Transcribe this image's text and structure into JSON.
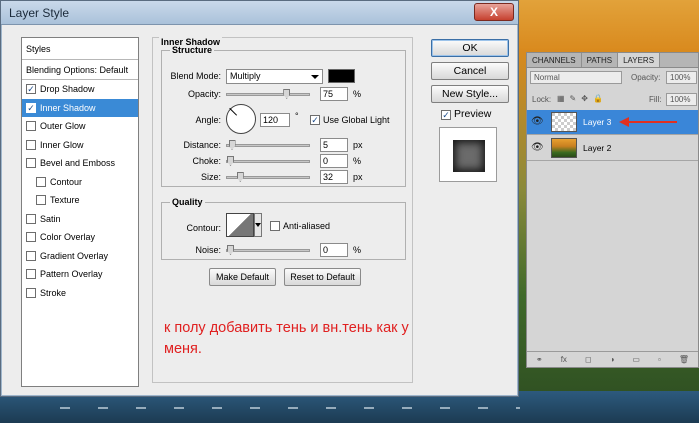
{
  "window": {
    "title": "Layer Style",
    "close": "X"
  },
  "styles": {
    "header": "Styles",
    "blending": "Blending Options: Default",
    "items": [
      {
        "label": "Drop Shadow",
        "checked": true
      },
      {
        "label": "Inner Shadow",
        "checked": true,
        "selected": true
      },
      {
        "label": "Outer Glow",
        "checked": false
      },
      {
        "label": "Inner Glow",
        "checked": false
      },
      {
        "label": "Bevel and Emboss",
        "checked": false
      },
      {
        "label": "Contour",
        "checked": false,
        "indent": true
      },
      {
        "label": "Texture",
        "checked": false,
        "indent": true
      },
      {
        "label": "Satin",
        "checked": false
      },
      {
        "label": "Color Overlay",
        "checked": false
      },
      {
        "label": "Gradient Overlay",
        "checked": false
      },
      {
        "label": "Pattern Overlay",
        "checked": false
      },
      {
        "label": "Stroke",
        "checked": false
      }
    ]
  },
  "inner_shadow": {
    "title": "Inner Shadow",
    "structure": "Structure",
    "blend_mode_label": "Blend Mode:",
    "blend_mode": "Multiply",
    "opacity_label": "Opacity:",
    "opacity": "75",
    "angle_label": "Angle:",
    "angle": "120",
    "degree": "°",
    "use_global_light": "Use Global Light",
    "distance_label": "Distance:",
    "distance": "5",
    "choke_label": "Choke:",
    "choke": "0",
    "size_label": "Size:",
    "size": "32",
    "percent": "%",
    "px": "px",
    "quality": "Quality",
    "contour_label": "Contour:",
    "anti_aliased": "Anti-aliased",
    "noise_label": "Noise:",
    "noise": "0",
    "make_default": "Make Default",
    "reset_default": "Reset to Default",
    "slider_levels": {
      "opacity": 0.75,
      "distance": 0.02,
      "choke": 0.0,
      "size": 0.13,
      "noise": 0.0
    }
  },
  "note": "к полу добавить тень и вн.тень как у меня.",
  "buttons": {
    "ok": "OK",
    "cancel": "Cancel",
    "new_style": "New Style...",
    "preview": "Preview"
  },
  "layers_panel": {
    "tabs": [
      "CHANNELS",
      "PATHS",
      "LAYERS"
    ],
    "blend": "Normal",
    "opacity_label": "Opacity:",
    "opacity": "100%",
    "lock_label": "Lock:",
    "fill_label": "Fill:",
    "fill": "100%",
    "layers": [
      {
        "name": "Layer 3",
        "selected": true
      },
      {
        "name": "Layer 2",
        "selected": false
      }
    ],
    "footer_icons": [
      "link-icon",
      "fx-icon",
      "mask-icon",
      "adjustment-icon",
      "folder-icon",
      "new-layer-icon",
      "trash-icon"
    ],
    "footer_glyphs": [
      "⚭",
      "fx",
      "◻",
      "◑",
      "▭",
      "▫",
      "🗑"
    ]
  },
  "colors": {
    "shadow_swatch": "#000000",
    "selection": "#3a8ad6",
    "arrow": "#e03020"
  }
}
